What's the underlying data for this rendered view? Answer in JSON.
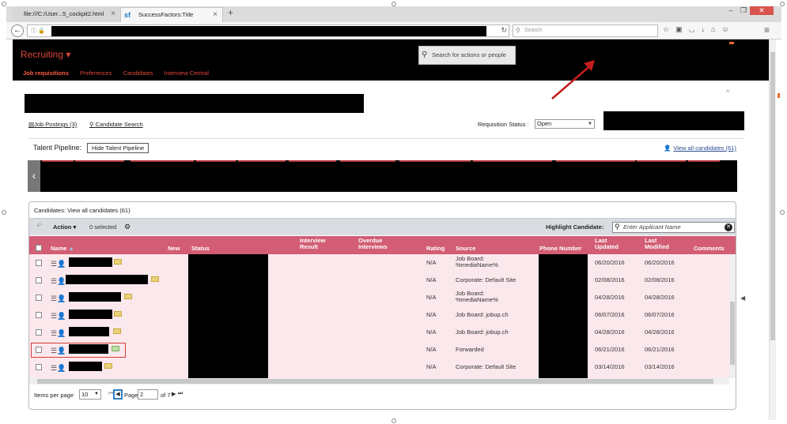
{
  "browser": {
    "tabs": [
      {
        "label": "file:///C:/User...5_cockpit2.html",
        "active": false
      },
      {
        "label": "SuccessFactors:Title",
        "active": true
      }
    ],
    "new_tab": "+",
    "search_placeholder": "Search",
    "window_buttons": [
      "–",
      "❐",
      "✕"
    ]
  },
  "app": {
    "module_label": "Recruiting ▾",
    "global_search_placeholder": "Search for actions or people",
    "nav": [
      {
        "label": "Job requisitions",
        "active": true
      },
      {
        "label": "Preferences",
        "active": false
      },
      {
        "label": "Candidates",
        "active": false
      },
      {
        "label": "Interview Central",
        "active": false
      }
    ],
    "accent_color": "#e0473a"
  },
  "subnav": {
    "job_postings": "Job Postings (3)",
    "candidate_search": "Candidate Search",
    "requisition_status_label": "Requisition Status :",
    "requisition_status_value": "Open"
  },
  "talent_pipeline": {
    "label": "Talent Pipeline:",
    "hide_button": "Hide Talent Pipeline",
    "view_all": "View all candidates (61)"
  },
  "candidates": {
    "panel_title": "Candidates: View all candidates (61)",
    "action_label": "Action",
    "selected_count": "0 selected",
    "highlight_label": "Highlight Candidate:",
    "highlight_placeholder": "Enter Applicant Name",
    "header_color": "#d25d74",
    "columns": {
      "name": "Name",
      "new": "New",
      "status": "Status",
      "interview_result": "Interview Result",
      "overdue_interviews": "Overdue Interviews",
      "rating": "Rating",
      "source": "Source",
      "phone_number": "Phone Number",
      "last_updated": "Last Updated",
      "last_modified": "Last Modified",
      "comments": "Comments"
    },
    "rows": [
      {
        "rating": "N/A",
        "source": "Job Board: %mediaName%",
        "last_updated": "06/20/2016",
        "last_modified": "06/20/2016"
      },
      {
        "rating": "N/A",
        "source": "Corporate: Default Site",
        "last_updated": "02/08/2016",
        "last_modified": "02/08/2016"
      },
      {
        "rating": "N/A",
        "source": "Job Board: %mediaName%",
        "last_updated": "04/28/2016",
        "last_modified": "04/28/2016"
      },
      {
        "rating": "N/A",
        "source": "Job Board: jobup.ch",
        "last_updated": "06/07/2016",
        "last_modified": "06/07/2016"
      },
      {
        "rating": "N/A",
        "source": "Job Board: jobup.ch",
        "last_updated": "04/28/2016",
        "last_modified": "04/28/2016"
      },
      {
        "rating": "N/A",
        "source": "Forwarded",
        "last_updated": "06/21/2016",
        "last_modified": "06/21/2016"
      },
      {
        "rating": "N/A",
        "source": "Corporate: Default Site",
        "last_updated": "03/14/2016",
        "last_modified": "03/14/2016"
      }
    ],
    "pager": {
      "items_per_page_label": "Items per page",
      "items_per_page": "10",
      "page_label": "Page",
      "page": "2",
      "of_label": "of 7"
    }
  }
}
